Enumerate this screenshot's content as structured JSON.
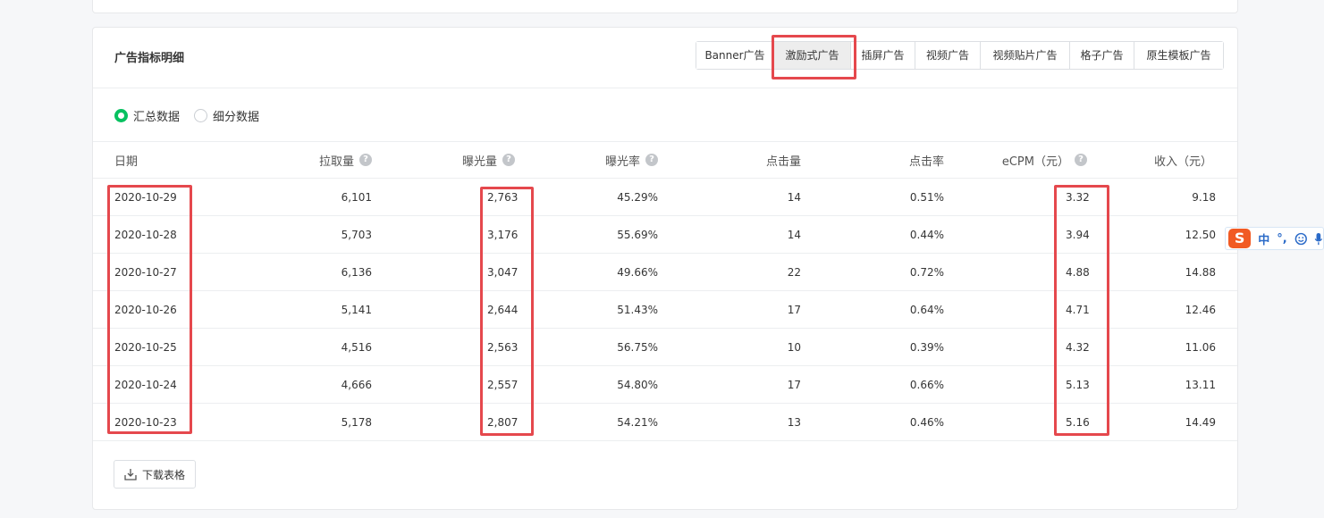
{
  "card_title": "广告指标明细",
  "tabs": [
    "Banner广告",
    "激励式广告",
    "插屏广告",
    "视频广告",
    "视频贴片广告",
    "格子广告",
    "原生模板广告"
  ],
  "active_tab": "激励式广告",
  "radios": {
    "summary": "汇总数据",
    "detail": "细分数据",
    "selected": "汇总数据"
  },
  "columns": {
    "date": "日期",
    "requests": "拉取量",
    "exposures": "曝光量",
    "exposure_rate": "曝光率",
    "clicks": "点击量",
    "ctr": "点击率",
    "ecpm": "eCPM（元）",
    "revenue": "收入（元）"
  },
  "rows": [
    {
      "date": "2020-10-29",
      "requests": "6,101",
      "exposures": "2,763",
      "exposure_rate": "45.29%",
      "clicks": "14",
      "ctr": "0.51%",
      "ecpm": "3.32",
      "revenue": "9.18"
    },
    {
      "date": "2020-10-28",
      "requests": "5,703",
      "exposures": "3,176",
      "exposure_rate": "55.69%",
      "clicks": "14",
      "ctr": "0.44%",
      "ecpm": "3.94",
      "revenue": "12.50"
    },
    {
      "date": "2020-10-27",
      "requests": "6,136",
      "exposures": "3,047",
      "exposure_rate": "49.66%",
      "clicks": "22",
      "ctr": "0.72%",
      "ecpm": "4.88",
      "revenue": "14.88"
    },
    {
      "date": "2020-10-26",
      "requests": "5,141",
      "exposures": "2,644",
      "exposure_rate": "51.43%",
      "clicks": "17",
      "ctr": "0.64%",
      "ecpm": "4.71",
      "revenue": "12.46"
    },
    {
      "date": "2020-10-25",
      "requests": "4,516",
      "exposures": "2,563",
      "exposure_rate": "56.75%",
      "clicks": "10",
      "ctr": "0.39%",
      "ecpm": "4.32",
      "revenue": "11.06"
    },
    {
      "date": "2020-10-24",
      "requests": "4,666",
      "exposures": "2,557",
      "exposure_rate": "54.80%",
      "clicks": "17",
      "ctr": "0.66%",
      "ecpm": "5.13",
      "revenue": "13.11"
    },
    {
      "date": "2020-10-23",
      "requests": "5,178",
      "exposures": "2,807",
      "exposure_rate": "54.21%",
      "clicks": "13",
      "ctr": "0.46%",
      "ecpm": "5.16",
      "revenue": "14.49"
    }
  ],
  "download_label": "下载表格",
  "ime": {
    "logo": "S",
    "mode": "中",
    "punct": "°,",
    "emoji_icon": "smiley-icon",
    "mic_icon": "mic-icon"
  },
  "colors": {
    "accent": "#07c160",
    "highlight": "#e5484d"
  }
}
